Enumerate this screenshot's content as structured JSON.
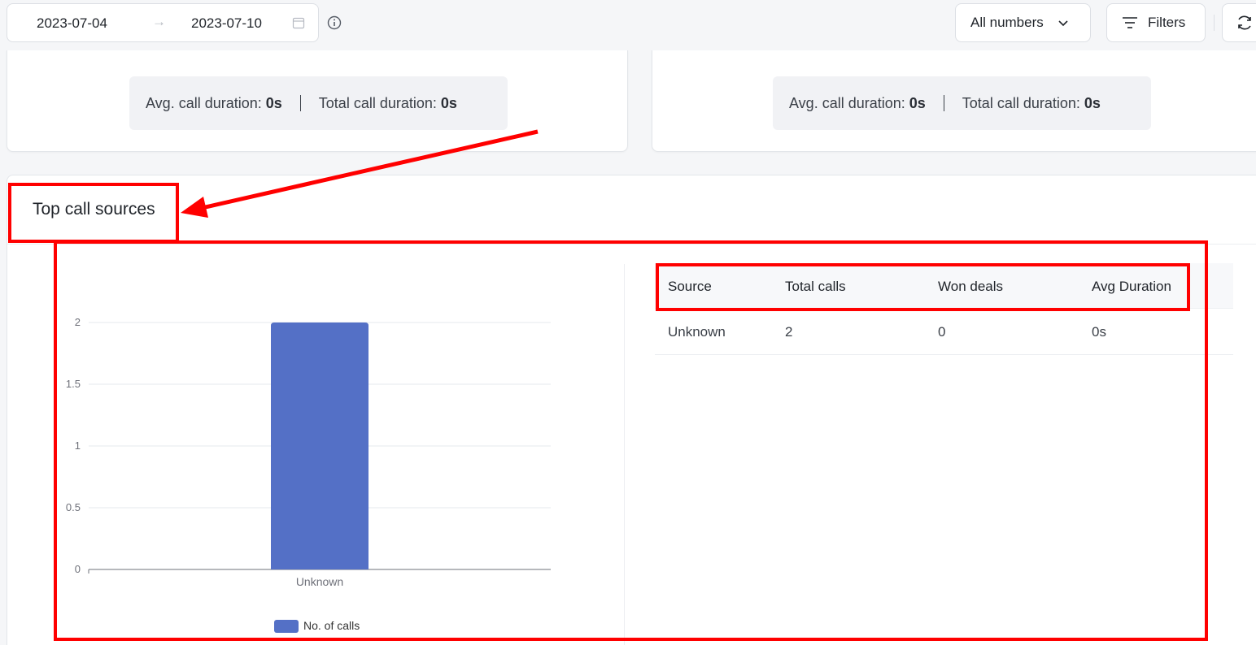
{
  "toolbar": {
    "date_start": "2023-07-04",
    "date_end": "2023-07-10",
    "arrow_glyph": "→",
    "numbers_select": "All numbers",
    "filters_label": "Filters"
  },
  "stat_cards": [
    {
      "avg_label": "Avg. call duration:",
      "avg_value": "0s",
      "total_label": "Total call duration:",
      "total_value": "0s"
    },
    {
      "avg_label": "Avg. call duration:",
      "avg_value": "0s",
      "total_label": "Total call duration:",
      "total_value": "0s"
    }
  ],
  "section": {
    "title": "Top call sources"
  },
  "table": {
    "headers": [
      "Source",
      "Total calls",
      "Won deals",
      "Avg Duration"
    ],
    "rows": [
      [
        "Unknown",
        "2",
        "0",
        "0s"
      ]
    ]
  },
  "chart_data": {
    "type": "bar",
    "categories": [
      "Unknown"
    ],
    "series": [
      {
        "name": "No. of calls",
        "values": [
          2
        ],
        "color": "#5470c6"
      }
    ],
    "ylim": [
      0,
      2
    ],
    "yticks": [
      "2",
      "1.5",
      "1",
      "0.5",
      "0"
    ],
    "legend": "bottom",
    "grid": true
  },
  "colors": {
    "accent": "#5470c6",
    "annotation": "#ff0000"
  },
  "icons": {
    "calendar": "calendar-icon",
    "info": "info-icon",
    "chevron": "chevron-down-icon",
    "filter": "filter-icon",
    "refresh": "refresh-icon"
  }
}
